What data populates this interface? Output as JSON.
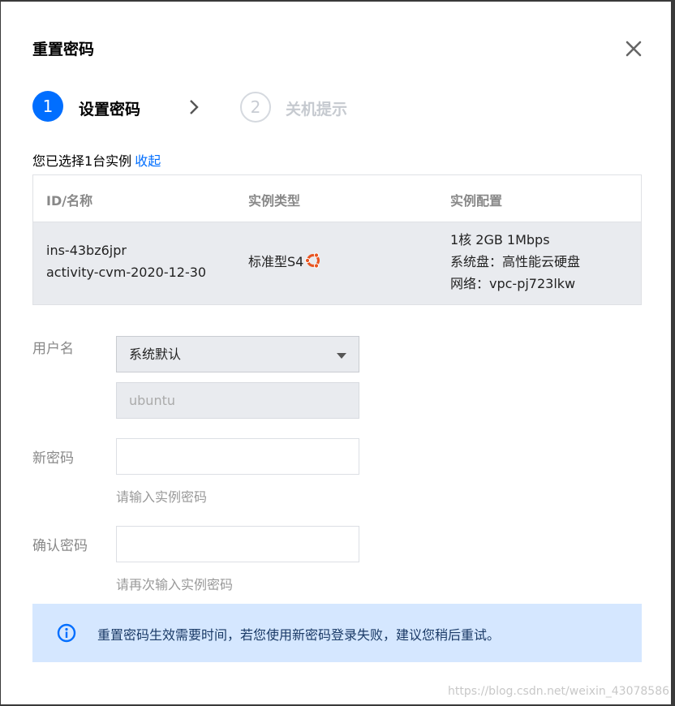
{
  "dialog": {
    "title": "重置密码",
    "close_icon": "close-icon"
  },
  "steps": [
    {
      "number": "1",
      "label": "设置密码",
      "state": "active"
    },
    {
      "number": "2",
      "label": "关机提示",
      "state": "pending"
    }
  ],
  "selection": {
    "summary": "您已选择1台实例",
    "toggle_link": "收起"
  },
  "instance_table": {
    "headers": [
      "ID/名称",
      "实例类型",
      "实例配置"
    ],
    "rows": [
      {
        "id": "ins-43bz6jpr",
        "name": "activity-cvm-2020-12-30",
        "type": "标准型S4",
        "os_icon": "ubuntu-icon",
        "config": [
          "1核 2GB 1Mbps",
          "系统盘：高性能云硬盘",
          "网络：vpc-pj723lkw"
        ]
      }
    ]
  },
  "form": {
    "username_label": "用户名",
    "username_select": "系统默认",
    "username_value": "ubuntu",
    "new_password_label": "新密码",
    "new_password_placeholder": "",
    "new_password_hint": "请输入实例密码",
    "confirm_password_label": "确认密码",
    "confirm_password_placeholder": "",
    "confirm_password_hint": "请再次输入实例密码"
  },
  "notice": {
    "icon": "info-icon",
    "text": "重置密码生效需要时间，若您使用新密码登录失败，建议您稍后重试。"
  },
  "watermark": "https://blog.csdn.net/weixin_43078586",
  "colors": {
    "accent": "#006eff",
    "notice_bg": "#d5e7ff",
    "row_bg": "#e9ebef"
  }
}
